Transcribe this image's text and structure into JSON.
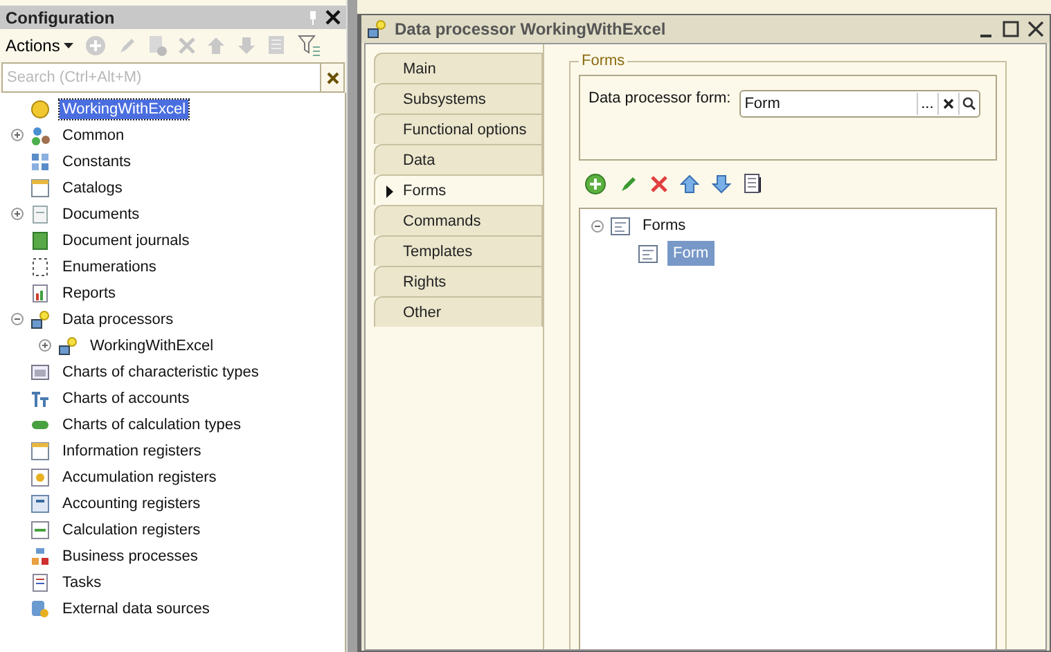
{
  "config_panel": {
    "title": "Configuration",
    "actions_label": "Actions",
    "search": {
      "placeholder": "Search (Ctrl+Alt+M)"
    },
    "tree": [
      {
        "label": "WorkingWithExcel",
        "kind": "root",
        "selected": true
      },
      {
        "label": "Common",
        "kind": "common",
        "selected": false,
        "expanded": false
      },
      {
        "label": "Constants",
        "kind": "constants",
        "selected": false
      },
      {
        "label": "Catalogs",
        "kind": "catalogs",
        "selected": false
      },
      {
        "label": "Documents",
        "kind": "documents",
        "selected": false,
        "expanded": false
      },
      {
        "label": "Document journals",
        "kind": "journals",
        "selected": false
      },
      {
        "label": "Enumerations",
        "kind": "enums",
        "selected": false
      },
      {
        "label": "Reports",
        "kind": "reports",
        "selected": false
      },
      {
        "label": "Data processors",
        "kind": "processor",
        "selected": false,
        "expanded": true,
        "children": [
          {
            "label": "WorkingWithExcel",
            "kind": "processor",
            "selected": false,
            "expanded": false
          }
        ]
      },
      {
        "label": "Charts of characteristic types",
        "kind": "charts",
        "selected": false
      },
      {
        "label": "Charts of accounts",
        "kind": "accounts",
        "selected": false
      },
      {
        "label": "Charts of calculation types",
        "kind": "calc",
        "selected": false
      },
      {
        "label": "Information registers",
        "kind": "catalogs",
        "selected": false
      },
      {
        "label": "Accumulation registers",
        "kind": "accum",
        "selected": false
      },
      {
        "label": "Accounting registers",
        "kind": "accreg",
        "selected": false
      },
      {
        "label": "Calculation registers",
        "kind": "calcreg",
        "selected": false
      },
      {
        "label": "Business processes",
        "kind": "bp",
        "selected": false
      },
      {
        "label": "Tasks",
        "kind": "tasks",
        "selected": false
      },
      {
        "label": "External data sources",
        "kind": "external",
        "selected": false
      }
    ]
  },
  "editor_window": {
    "title": "Data processor WorkingWithExcel",
    "tabs": [
      {
        "label": "Main",
        "selected": false
      },
      {
        "label": "Subsystems",
        "selected": false
      },
      {
        "label": "Functional options",
        "selected": false
      },
      {
        "label": "Data",
        "selected": false
      },
      {
        "label": "Forms",
        "selected": true
      },
      {
        "label": "Commands",
        "selected": false
      },
      {
        "label": "Templates",
        "selected": false
      },
      {
        "label": "Rights",
        "selected": false
      },
      {
        "label": "Other",
        "selected": false
      }
    ],
    "group_title": "Forms",
    "form_field": {
      "label": "Data processor form:",
      "value": "Form",
      "choice_button": "..."
    },
    "forms_tree": [
      {
        "label": "Forms",
        "selected": false,
        "expanded": true,
        "children": [
          {
            "label": "Form",
            "selected": true
          }
        ]
      }
    ]
  }
}
